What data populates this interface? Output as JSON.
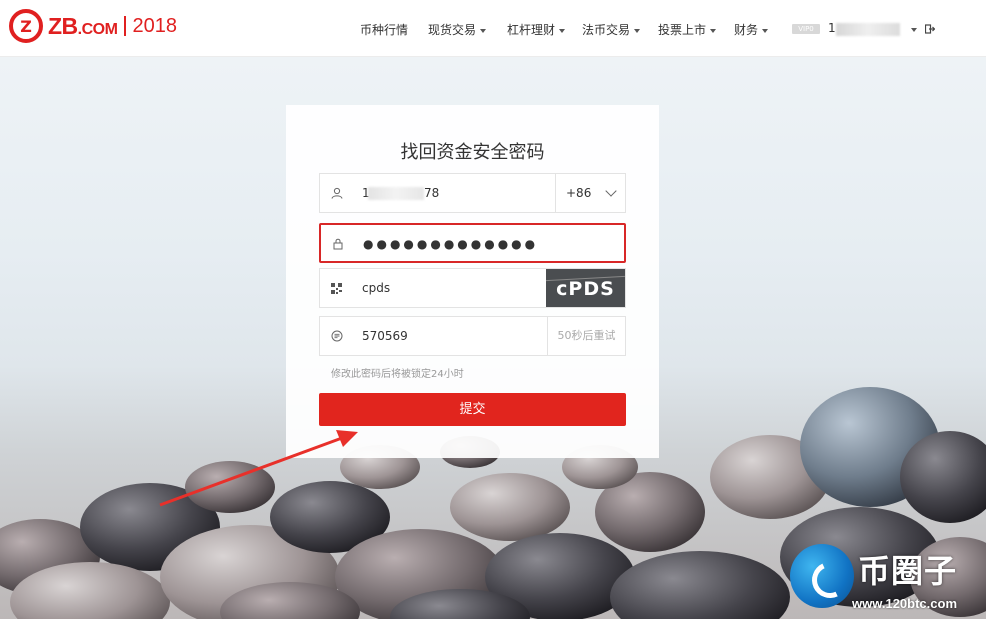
{
  "header": {
    "logo_text": "ZB.COM",
    "logo_year": "2018",
    "nav": [
      {
        "label": "币种行情",
        "has_caret": false
      },
      {
        "label": "现货交易",
        "has_caret": true
      },
      {
        "label": "杠杆理财",
        "has_caret": true
      },
      {
        "label": "法币交易",
        "has_caret": true
      },
      {
        "label": "投票上市",
        "has_caret": true
      },
      {
        "label": "财务",
        "has_caret": true
      }
    ],
    "vip_badge": "VIP0",
    "username_visible": "1"
  },
  "form": {
    "title": "找回资金安全密码",
    "phone": {
      "visible_prefix": "1",
      "visible_suffix": "78",
      "country_code": "+86"
    },
    "password": {
      "value": "●●●●●●●●●●●●●"
    },
    "captcha": {
      "value": "cpds",
      "image_text": "cPDS"
    },
    "sms": {
      "value": "570569",
      "resend_label": "50秒后重试"
    },
    "hint": "修改此密码后将被锁定24小时",
    "submit_label": "提交"
  },
  "watermark": {
    "title": "币圈子",
    "url": "www.120btc.com"
  },
  "colors": {
    "brand_red": "#e02020",
    "submit_red": "#e1251e",
    "highlight_border": "#d82727",
    "arrow": "#e8302a"
  },
  "icons": [
    "user-icon",
    "lock-icon",
    "captcha-icon",
    "message-icon",
    "logout-icon",
    "chevron-down-icon"
  ]
}
